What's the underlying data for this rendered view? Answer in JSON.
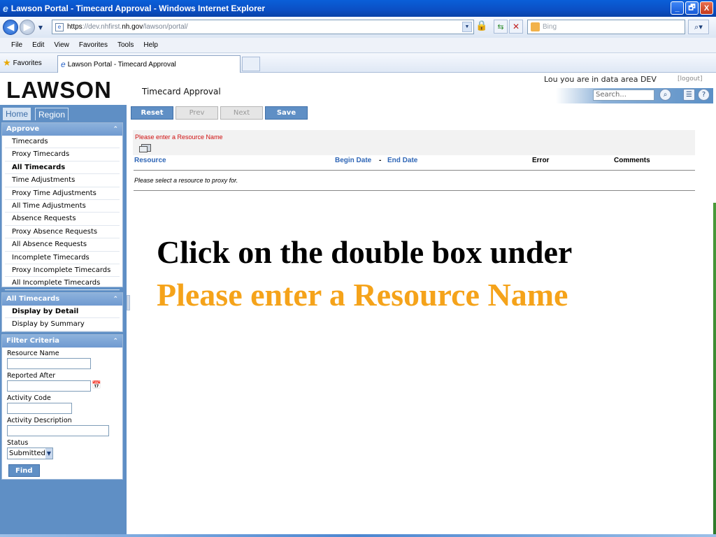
{
  "window": {
    "title": "Lawson Portal - Timecard Approval - Windows Internet Explorer",
    "minimize": "_",
    "restore": "🗗",
    "close": "X"
  },
  "browser": {
    "url_scheme": "https",
    "url_host_prefix": "://dev.nhfirst.",
    "url_host_domain": "nh.gov",
    "url_path": "/lawson/portal/",
    "search_placeholder": "Bing",
    "menu": [
      "File",
      "Edit",
      "View",
      "Favorites",
      "Tools",
      "Help"
    ],
    "favorites_label": "Favorites",
    "tab_title": "Lawson Portal - Timecard Approval"
  },
  "portal": {
    "logo": "LAWSON",
    "app_title": "Timecard Approval",
    "user_info": "Lou you are in data area DEV",
    "logout": "[logout]",
    "search_placeholder": "Search..."
  },
  "nav": {
    "home_tab": "Home",
    "region_tab": "Region",
    "approve": {
      "title": "Approve",
      "items": [
        {
          "label": "Timecards"
        },
        {
          "label": "Proxy Timecards"
        },
        {
          "label": "All Timecards"
        },
        {
          "label": "Time Adjustments"
        },
        {
          "label": "Proxy Time Adjustments"
        },
        {
          "label": "All Time Adjustments"
        },
        {
          "label": "Absence Requests"
        },
        {
          "label": "Proxy Absence Requests"
        },
        {
          "label": "All Absence Requests"
        },
        {
          "label": "Incomplete Timecards"
        },
        {
          "label": "Proxy Incomplete Timecards"
        },
        {
          "label": "All Incomplete Timecards"
        }
      ]
    },
    "all_timecards": {
      "title": "All Timecards",
      "items": [
        {
          "label": "Display by Detail"
        },
        {
          "label": "Display by Summary"
        }
      ]
    },
    "filter": {
      "title": "Filter Criteria",
      "resource_name": "Resource Name",
      "reported_after": "Reported After",
      "activity_code": "Activity Code",
      "activity_description": "Activity Description",
      "status": "Status",
      "status_value": "Submitted",
      "find": "Find"
    }
  },
  "toolbar": {
    "reset": "Reset",
    "prev": "Prev",
    "next": "Next",
    "save": "Save"
  },
  "content": {
    "error_message": "Please enter a Resource Name",
    "columns": {
      "resource": "Resource",
      "begin_date": "Begin Date",
      "dash": "-",
      "end_date": "End Date",
      "error": "Error",
      "comments": "Comments"
    },
    "empty_message": "Please select a resource to proxy for."
  },
  "instruction": {
    "line1": "Click on the double box under",
    "line2": "Please enter a Resource Name"
  }
}
